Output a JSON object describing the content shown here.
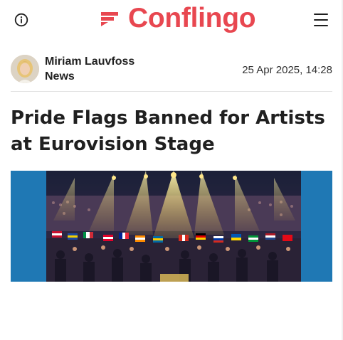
{
  "header": {
    "brand_name": "Conflingo",
    "brand_color": "#e84750",
    "left_icon": "info-icon",
    "right_icon": "hamburger-menu-icon"
  },
  "article": {
    "author_name": "Miriam Lauvfoss",
    "section": "News",
    "timestamp": "25 Apr 2025, 14:28",
    "title": "Pride Flags Banned for Artists at Eurovision Stage",
    "hero_image": "concert-crowd-with-flags-illustration"
  }
}
